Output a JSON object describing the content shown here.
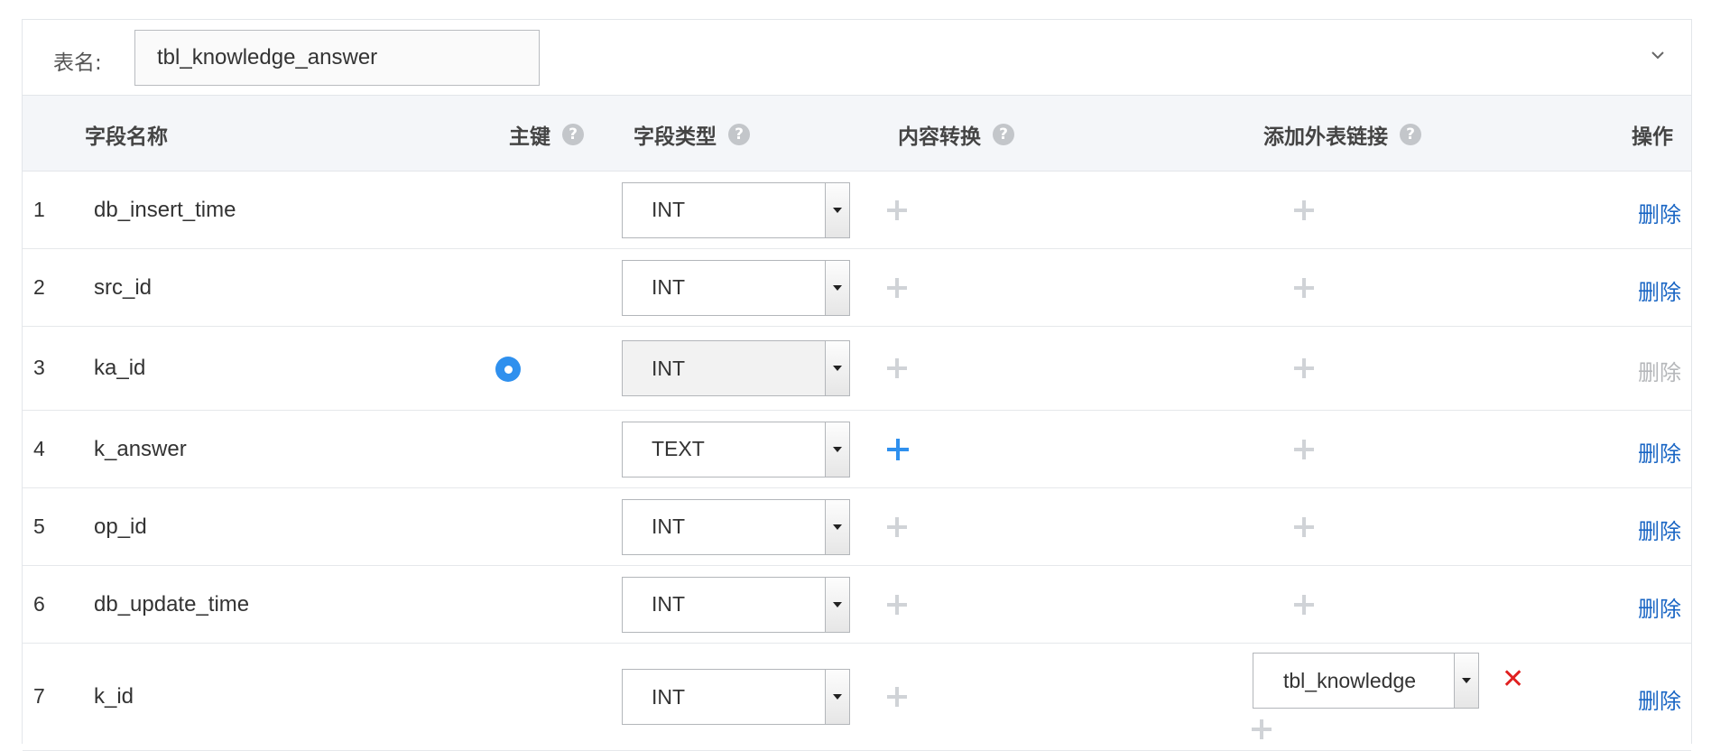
{
  "table_name": {
    "label": "表名:",
    "value": "tbl_knowledge_answer"
  },
  "columns": {
    "field_name": "字段名称",
    "primary_key": "主键",
    "field_type": "字段类型",
    "content_transform": "内容转换",
    "add_foreign_link": "添加外表链接",
    "actions": "操作"
  },
  "rows": [
    {
      "num": "1",
      "field": "db_insert_time",
      "primary": false,
      "type": "INT",
      "transform_active": false,
      "foreign_table": null,
      "delete_label": "删除",
      "delete_enabled": true
    },
    {
      "num": "2",
      "field": "src_id",
      "primary": false,
      "type": "INT",
      "transform_active": false,
      "foreign_table": null,
      "delete_label": "删除",
      "delete_enabled": true
    },
    {
      "num": "3",
      "field": "ka_id",
      "primary": true,
      "type": "INT",
      "transform_active": false,
      "foreign_table": null,
      "delete_label": "删除",
      "delete_enabled": false
    },
    {
      "num": "4",
      "field": "k_answer",
      "primary": false,
      "type": "TEXT",
      "transform_active": true,
      "foreign_table": null,
      "delete_label": "删除",
      "delete_enabled": true
    },
    {
      "num": "5",
      "field": "op_id",
      "primary": false,
      "type": "INT",
      "transform_active": false,
      "foreign_table": null,
      "delete_label": "删除",
      "delete_enabled": true
    },
    {
      "num": "6",
      "field": "db_update_time",
      "primary": false,
      "type": "INT",
      "transform_active": false,
      "foreign_table": null,
      "delete_label": "删除",
      "delete_enabled": true
    },
    {
      "num": "7",
      "field": "k_id",
      "primary": false,
      "type": "INT",
      "transform_active": false,
      "foreign_table": "tbl_knowledge",
      "delete_label": "删除",
      "delete_enabled": true
    }
  ],
  "colors": {
    "accent": "#2f90ee",
    "link": "#1a66c4",
    "danger": "#e02020"
  }
}
